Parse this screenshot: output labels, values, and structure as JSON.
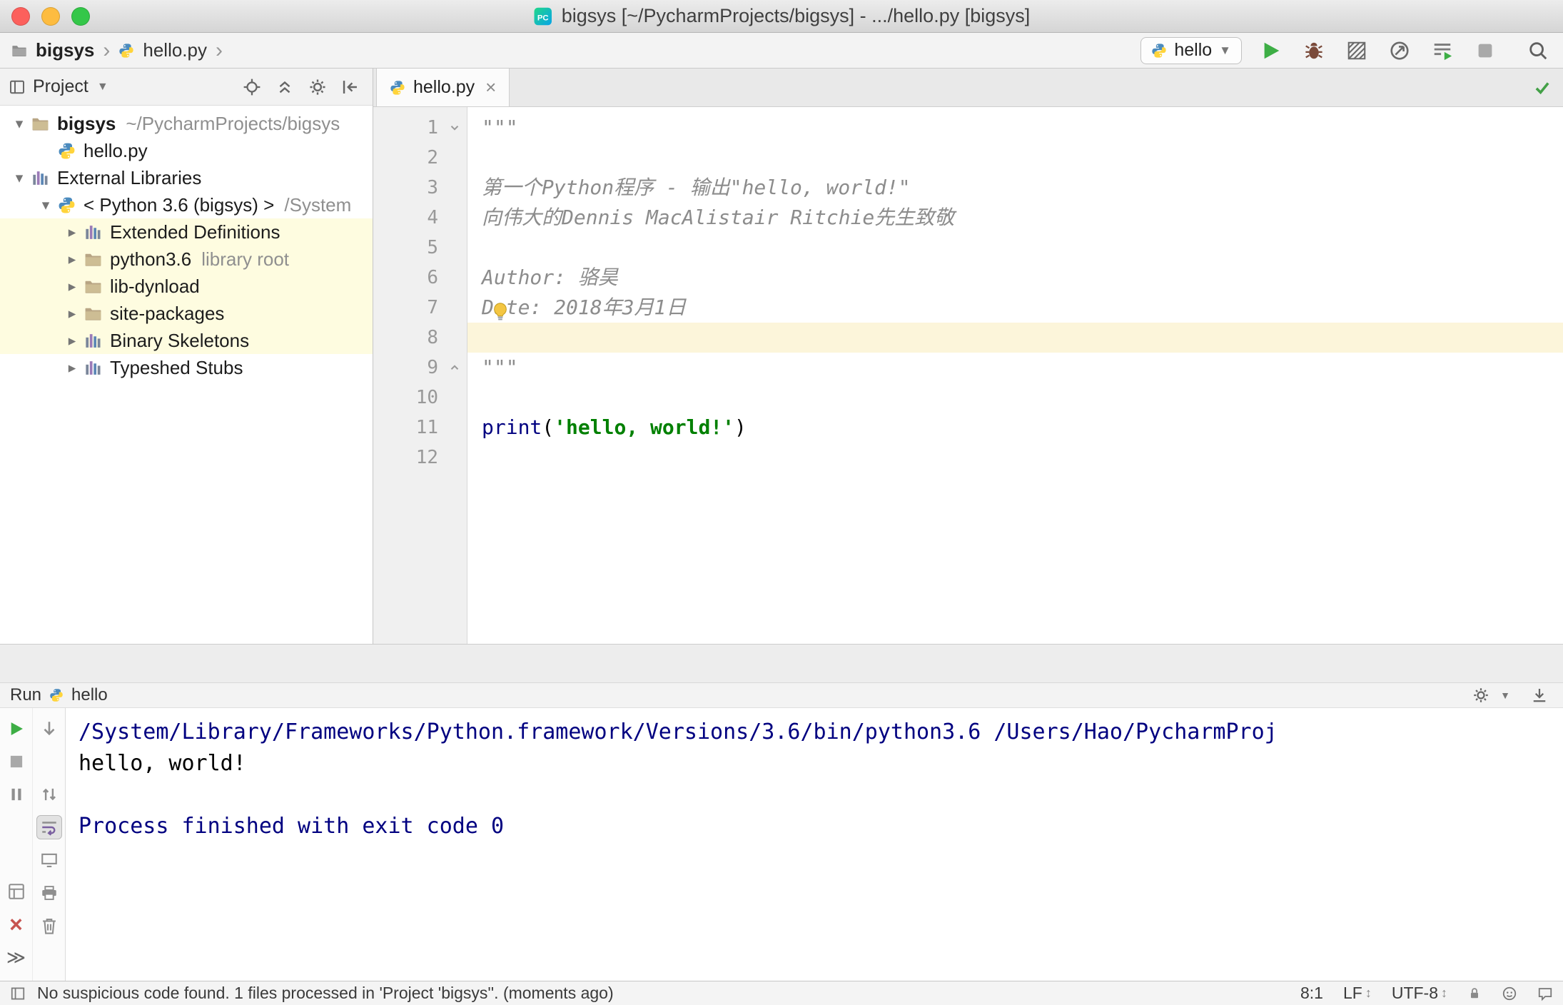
{
  "titlebar": {
    "title": "bigsys [~/PycharmProjects/bigsys] - .../hello.py [bigsys]"
  },
  "navbar": {
    "breadcrumb": {
      "project": "bigsys",
      "file": "hello.py"
    },
    "run_config": "hello",
    "actions": [
      "run-icon",
      "debug-icon",
      "coverage-icon",
      "profiler-icon",
      "run-with-console-icon",
      "stop-icon",
      "search-everywhere-icon"
    ]
  },
  "project_panel": {
    "header": {
      "title": "Project",
      "actions": [
        "locate-icon",
        "collapse-all-icon",
        "settings-gear-icon",
        "hide-panel-icon"
      ]
    },
    "tree": [
      {
        "label": "bigsys",
        "suffix": "~/PycharmProjects/bigsys",
        "icon": "folder",
        "arrow": "open",
        "indent": 0,
        "bold": true
      },
      {
        "label": "hello.py",
        "icon": "python",
        "arrow": "none",
        "indent": 1
      },
      {
        "label": "External Libraries",
        "icon": "library",
        "arrow": "open",
        "indent": 0
      },
      {
        "label": "< Python 3.6 (bigsys) >",
        "suffix": "/System",
        "icon": "python",
        "arrow": "open",
        "indent": 1
      },
      {
        "label": "Extended Definitions",
        "icon": "library",
        "arrow": "closed",
        "indent": 2,
        "highlight": true
      },
      {
        "label": "python3.6",
        "suffix": "library root",
        "icon": "folder",
        "arrow": "closed",
        "indent": 2,
        "highlight": true
      },
      {
        "label": "lib-dynload",
        "icon": "folder",
        "arrow": "closed",
        "indent": 2,
        "highlight": true
      },
      {
        "label": "site-packages",
        "icon": "folder",
        "arrow": "closed",
        "indent": 2,
        "highlight": true
      },
      {
        "label": "Binary Skeletons",
        "icon": "library",
        "arrow": "closed",
        "indent": 2,
        "highlight": true
      },
      {
        "label": "Typeshed Stubs",
        "icon": "library",
        "arrow": "closed",
        "indent": 2
      }
    ]
  },
  "editor": {
    "tab": {
      "label": "hello.py"
    },
    "caret_line": 8,
    "lines": [
      {
        "n": 1,
        "fold": "open",
        "tokens": [
          {
            "t": "\"\"\"",
            "s": "doc"
          }
        ]
      },
      {
        "n": 2,
        "tokens": []
      },
      {
        "n": 3,
        "tokens": [
          {
            "t": "第一个Python程序 - 输出\"hello, world!\"",
            "s": "doc"
          }
        ]
      },
      {
        "n": 4,
        "tokens": [
          {
            "t": "向伟大的Dennis MacAlistair Ritchie先生致敬",
            "s": "doc"
          }
        ]
      },
      {
        "n": 5,
        "tokens": []
      },
      {
        "n": 6,
        "tokens": [
          {
            "t": "Author: 骆昊",
            "s": "doc"
          }
        ]
      },
      {
        "n": 7,
        "tokens": [
          {
            "t": "Date: 2018年3月1日",
            "s": "doc"
          }
        ]
      },
      {
        "n": 8,
        "tokens": []
      },
      {
        "n": 9,
        "fold": "close",
        "tokens": [
          {
            "t": "\"\"\"",
            "s": "doc"
          }
        ]
      },
      {
        "n": 10,
        "tokens": []
      },
      {
        "n": 11,
        "tokens": [
          {
            "t": "print",
            "s": "builtin"
          },
          {
            "t": "(",
            "s": "plain"
          },
          {
            "t": "'hello, world!'",
            "s": "string"
          },
          {
            "t": ")",
            "s": "plain"
          }
        ]
      },
      {
        "n": 12,
        "tokens": []
      }
    ]
  },
  "run_panel": {
    "title": "Run",
    "config": "hello",
    "header_actions": [
      "settings-gear-icon",
      "dock-icon"
    ],
    "toolbar_main": [
      "rerun-icon",
      "stop-icon",
      "pause-output-icon",
      "restore-layout-icon",
      "close-icon",
      "more-icon"
    ],
    "toolbar_console": [
      "scroll-down-icon",
      "navigate-frames-icon",
      "soft-wrap-icon",
      "show-console-icon",
      "print-icon",
      "clear-all-icon"
    ],
    "soft_wrap_active": true,
    "console": [
      {
        "text": "/System/Library/Frameworks/Python.framework/Versions/3.6/bin/python3.6 /Users/Hao/PycharmProj",
        "style": "system"
      },
      {
        "text": "hello, world!",
        "style": "stdout"
      },
      {
        "text": "",
        "style": "stdout"
      },
      {
        "text": "Process finished with exit code 0",
        "style": "system"
      }
    ]
  },
  "statusbar": {
    "message": "No suspicious code found. 1 files processed in 'Project 'bigsys''. (moments ago)",
    "caret_position": "8:1",
    "line_separator": "LF",
    "encoding": "UTF-8",
    "right_icons": [
      "lock-icon",
      "hector-inspector-icon",
      "event-log-icon"
    ]
  },
  "colors": {
    "docstring": "#8C8C8C",
    "builtin": "#000080",
    "string": "#008000",
    "console_system": "#000080",
    "caret_line_bg": "#FCF5DA",
    "tree_highlight_bg": "#FEFCE0",
    "run_green": "#3DAE45"
  }
}
